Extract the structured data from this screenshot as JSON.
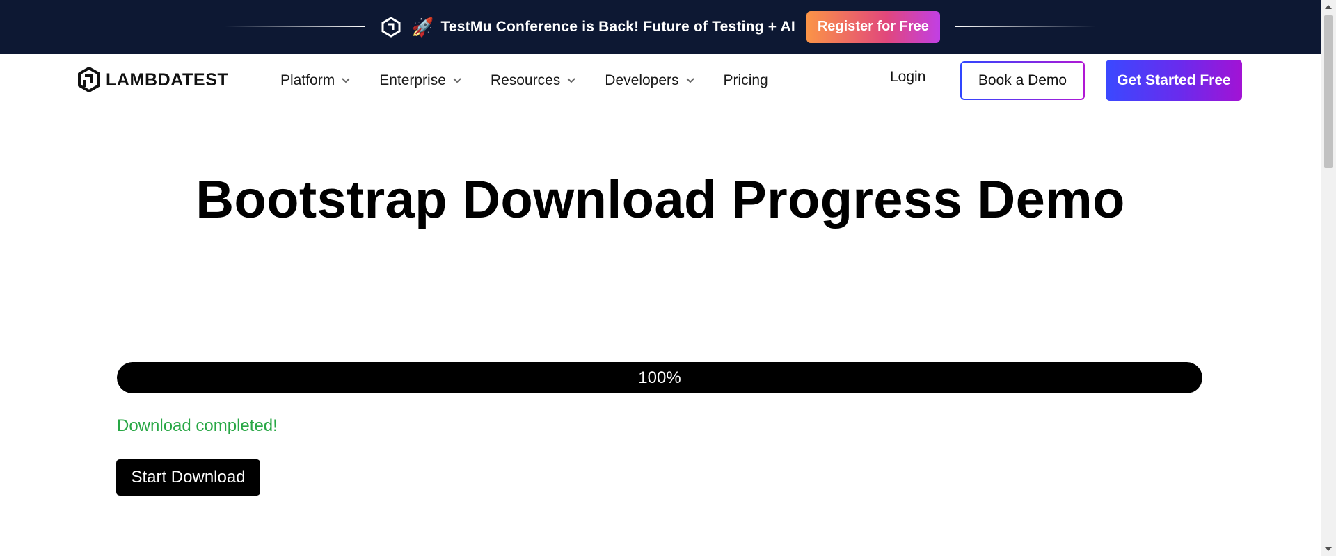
{
  "banner": {
    "rocket": "🚀",
    "text": "TestMu Conference is Back! Future of Testing + AI",
    "register_label": "Register for Free",
    "background": "#0d1833"
  },
  "nav": {
    "brand": "LAMBDATEST",
    "items": [
      {
        "label": "Platform",
        "has_dropdown": true,
        "icon": "chevron-down-icon"
      },
      {
        "label": "Enterprise",
        "has_dropdown": true,
        "icon": "chevron-down-icon"
      },
      {
        "label": "Resources",
        "has_dropdown": true,
        "icon": "chevron-down-icon"
      },
      {
        "label": "Developers",
        "has_dropdown": true,
        "icon": "chevron-down-icon"
      },
      {
        "label": "Pricing",
        "has_dropdown": false
      }
    ],
    "login_label": "Login",
    "demo_label": "Book a Demo",
    "started_label": "Get Started Free",
    "accent_start": "#3a49ff",
    "accent_end": "#a213d4"
  },
  "main": {
    "title": "Bootstrap Download Progress Demo",
    "progress": {
      "value": 100,
      "label": "100%"
    },
    "status": "Download completed!",
    "status_color": "#28a745",
    "download_label": "Start Download"
  }
}
